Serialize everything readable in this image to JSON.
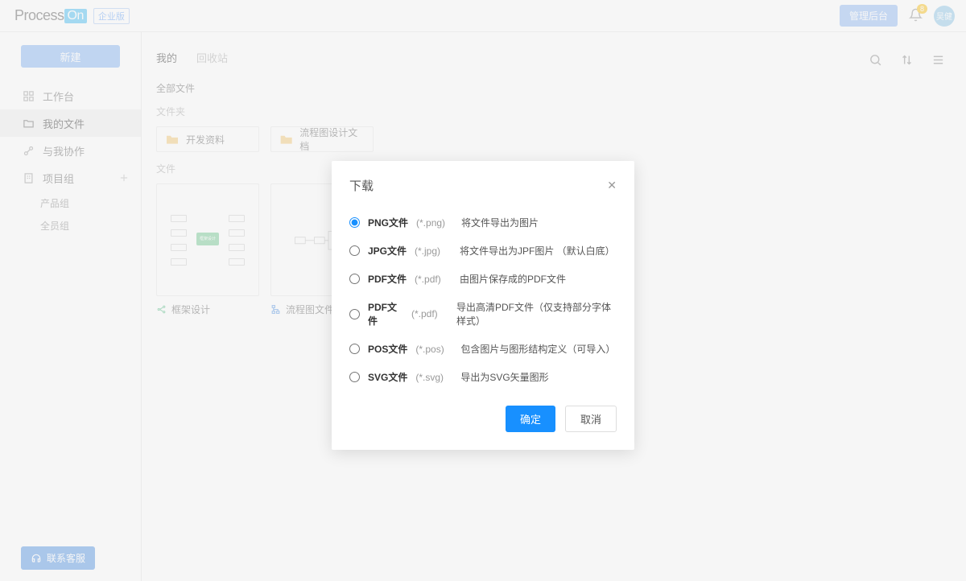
{
  "header": {
    "logo_first": "Process",
    "logo_last": "On",
    "edition": "企业版",
    "admin_btn": "管理后台",
    "badge": "8",
    "avatar": "吴健"
  },
  "sidebar": {
    "new_btn": "新建",
    "items": [
      {
        "label": "工作台",
        "icon": "grid-icon"
      },
      {
        "label": "我的文件",
        "icon": "folder-outline-icon"
      },
      {
        "label": "与我协作",
        "icon": "share-icon"
      }
    ],
    "group": {
      "label": "项目组",
      "icon": "building-icon"
    },
    "subs": [
      {
        "label": "产品组"
      },
      {
        "label": "全员组"
      }
    ],
    "contact": "联系客服"
  },
  "main": {
    "tabs": {
      "mine": "我的",
      "trash": "回收站"
    },
    "crumb": "全部文件",
    "folder_label": "文件夹",
    "folders": [
      {
        "name": "开发资料"
      },
      {
        "name": "流程图设计文档"
      }
    ],
    "file_label": "文件",
    "files": [
      {
        "name": "框架设计",
        "type": "mindmap"
      },
      {
        "name": "流程图文件",
        "type": "flow"
      }
    ]
  },
  "modal": {
    "title": "下载",
    "options": [
      {
        "label": "PNG文件",
        "ext": "(*.png)",
        "desc": "将文件导出为图片",
        "selected": true
      },
      {
        "label": "JPG文件",
        "ext": "(*.jpg)",
        "desc": "将文件导出为JPF图片 （默认白底）",
        "selected": false
      },
      {
        "label": "PDF文件",
        "ext": "(*.pdf)",
        "desc": "由图片保存成的PDF文件",
        "selected": false
      },
      {
        "label": "PDF文件",
        "ext": "(*.pdf)",
        "desc": "导出高清PDF文件（仅支持部分字体样式）",
        "selected": false
      },
      {
        "label": "POS文件",
        "ext": "(*.pos)",
        "desc": "包含图片与图形结构定义（可导入）",
        "selected": false
      },
      {
        "label": "SVG文件",
        "ext": "(*.svg)",
        "desc": "导出为SVG矢量图形",
        "selected": false
      }
    ],
    "ok": "确定",
    "cancel": "取消"
  }
}
